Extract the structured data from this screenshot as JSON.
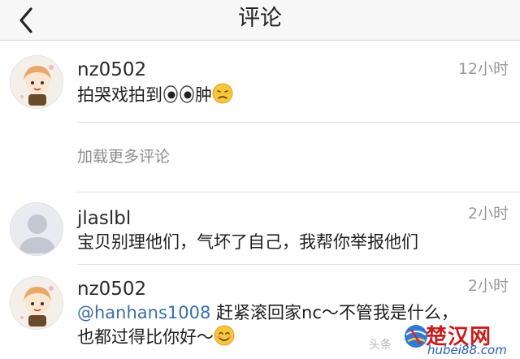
{
  "header": {
    "title": "评论",
    "back_icon": "chevron-left-icon"
  },
  "comments": [
    {
      "username": "nz0502",
      "time": "12小时",
      "text_before": "拍哭戏拍到",
      "text_after": "肿",
      "emojis": [
        "eyes",
        "disappointed-face"
      ]
    },
    {
      "username": "jlaslbl",
      "time": "2小时",
      "text": "宝贝别理他们，气坏了自己，我帮你举报他们"
    },
    {
      "username": "nz0502",
      "time": "2小时",
      "mention": "@hanhans1008",
      "text_line1": " 赶紧滚回家nc～不管我是什么，",
      "text_line2": "也都过得比你好～",
      "emoji": "smiling-face"
    }
  ],
  "load_more": "加载更多评论",
  "watermark": {
    "brand": "楚汉网",
    "domain": "hubei88.com",
    "faint": "头条"
  },
  "colors": {
    "mention": "#3a6ea5",
    "time": "#9a9a9a",
    "watermark_red": "#c81d1d",
    "watermark_blue": "#1f5fb3"
  }
}
